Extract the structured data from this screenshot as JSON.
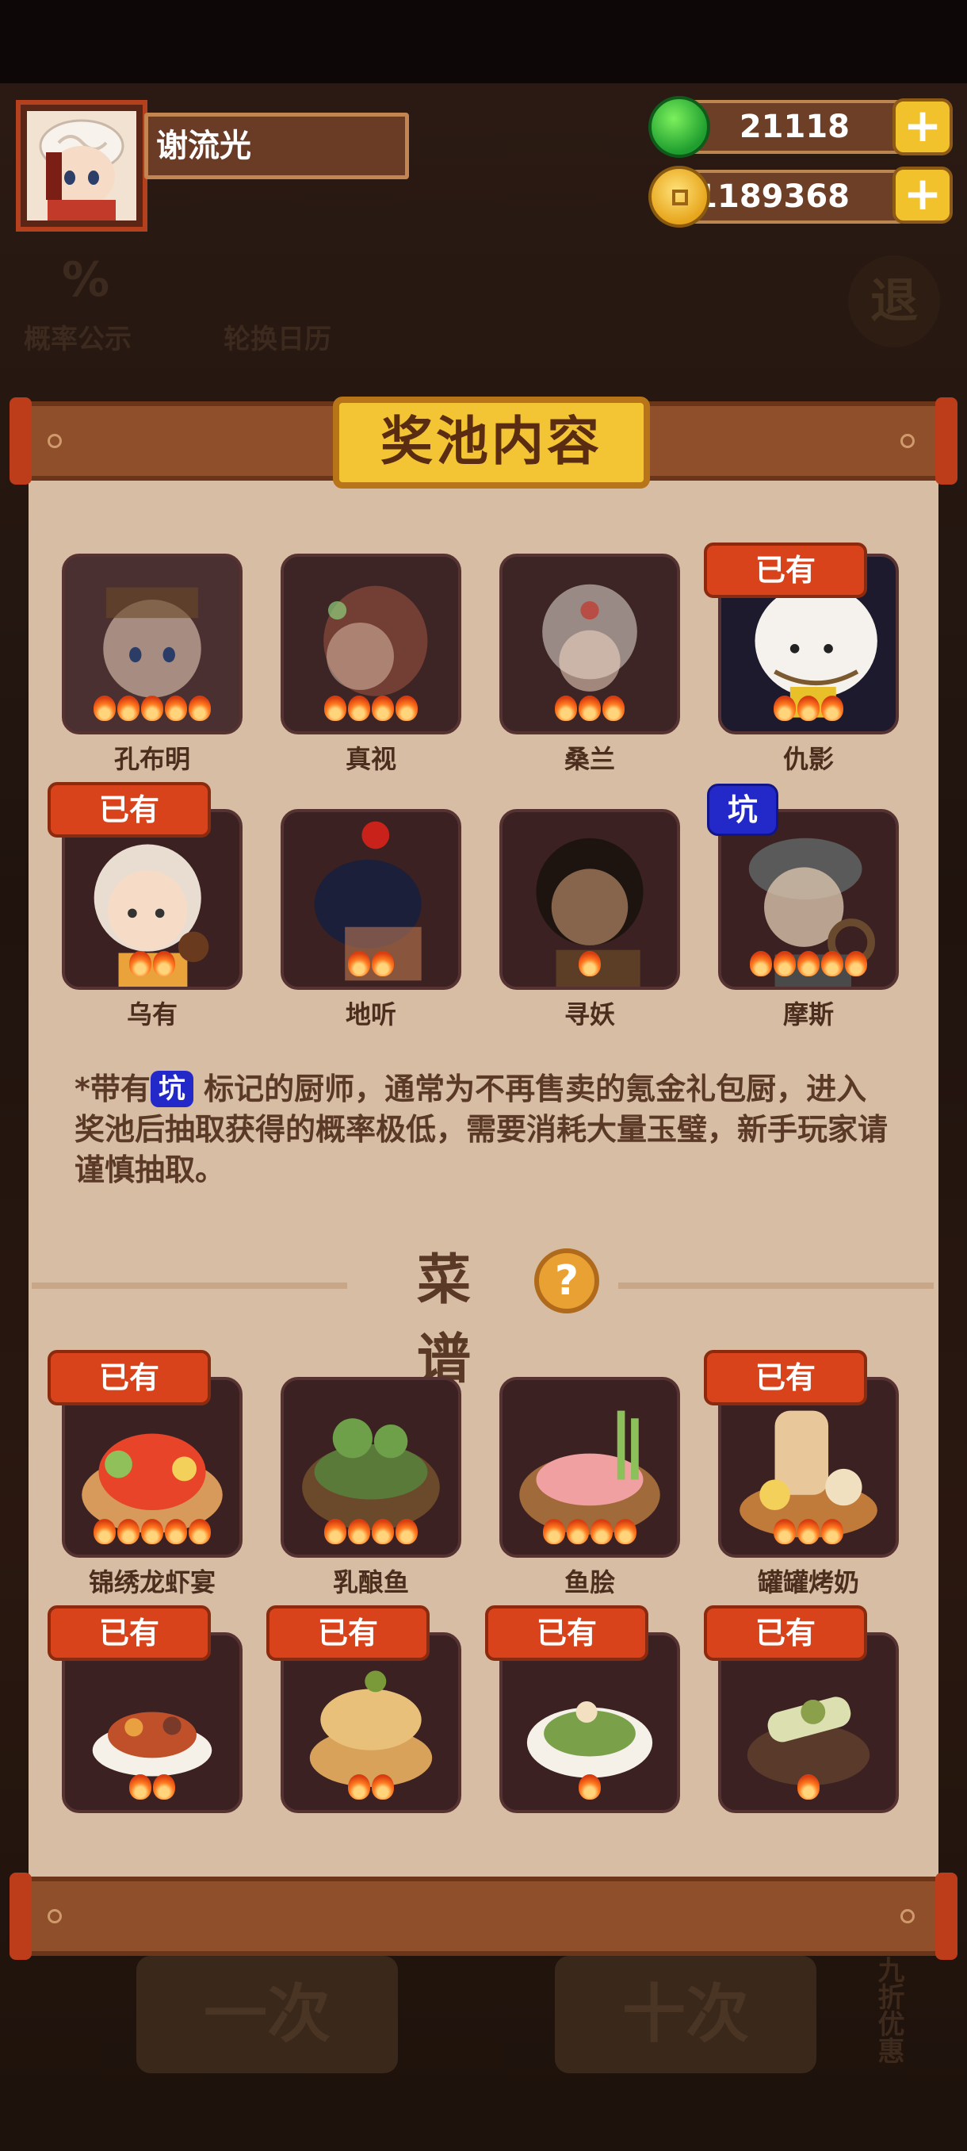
{
  "header": {
    "player_name": "谢流光",
    "currency_jade": "21118",
    "currency_coin": "1189368",
    "plus_label": "+"
  },
  "background": {
    "prob_icon": "%",
    "prob_label": "概率公示",
    "calendar_label": "轮换日历",
    "exit_label": "退",
    "btn_one": "一次",
    "btn_ten": "十次",
    "discount_label": "九折优惠"
  },
  "modal": {
    "title": "奖池内容",
    "chefs": [
      {
        "name": "孔布明",
        "stars": 5,
        "badge": ""
      },
      {
        "name": "真视",
        "stars": 4,
        "badge": ""
      },
      {
        "name": "桑兰",
        "stars": 3,
        "badge": ""
      },
      {
        "name": "仇影",
        "stars": 3,
        "badge": "已有"
      },
      {
        "name": "乌有",
        "stars": 2,
        "badge": "已有"
      },
      {
        "name": "地听",
        "stars": 2,
        "badge": ""
      },
      {
        "name": "寻妖",
        "stars": 1,
        "badge": ""
      },
      {
        "name": "摩斯",
        "stars": 5,
        "badge": "坑"
      }
    ],
    "note_prefix": "*带有",
    "note_keng": "坑",
    "note_rest": " 标记的厨师，通常为不再售卖的氪金礼包厨，进入奖池后抽取获得的概率极低，需要消耗大量玉璧，新手玩家请谨慎抽取。",
    "recipe_title": "菜谱",
    "help_icon": "?",
    "recipes": [
      {
        "name": "锦绣龙虾宴",
        "stars": 5,
        "badge": "已有"
      },
      {
        "name": "乳酿鱼",
        "stars": 4,
        "badge": ""
      },
      {
        "name": "鱼脍",
        "stars": 4,
        "badge": ""
      },
      {
        "name": "罐罐烤奶",
        "stars": 3,
        "badge": "已有"
      },
      {
        "name": "",
        "stars": 2,
        "badge": "已有"
      },
      {
        "name": "",
        "stars": 2,
        "badge": "已有"
      },
      {
        "name": "",
        "stars": 1,
        "badge": "已有"
      },
      {
        "name": "",
        "stars": 1,
        "badge": "已有"
      }
    ]
  }
}
